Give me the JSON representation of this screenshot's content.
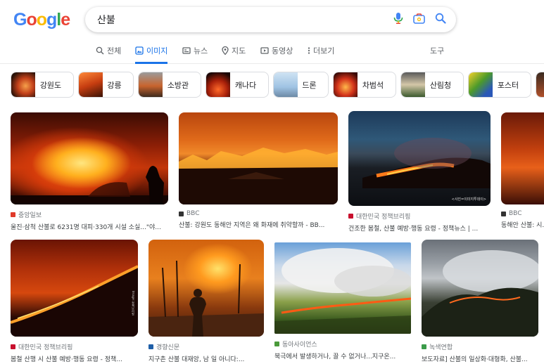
{
  "search": {
    "query": "산불"
  },
  "logo": {
    "letters": [
      "G",
      "o",
      "o",
      "g",
      "l",
      "e"
    ],
    "colors": [
      "#4285f4",
      "#ea4335",
      "#fbbc05",
      "#4285f4",
      "#34a853",
      "#ea4335"
    ]
  },
  "tabs": [
    {
      "label": "전체",
      "icon": "search-icon"
    },
    {
      "label": "이미지",
      "icon": "image-icon",
      "active": true
    },
    {
      "label": "뉴스",
      "icon": "news-icon"
    },
    {
      "label": "지도",
      "icon": "map-pin-icon"
    },
    {
      "label": "동영상",
      "icon": "video-icon"
    },
    {
      "label": "더보기",
      "icon": "more-icon"
    }
  ],
  "tools_label": "도구",
  "chips": [
    "강원도",
    "강릉",
    "소방관",
    "캐나다",
    "드론",
    "차범석",
    "산림청",
    "포스터"
  ],
  "results": [
    {
      "source": "중앙일보",
      "title": "울진·삼척 산불로 6231명 대피·330개 시설 소실...\"야...",
      "fav": "#e03a2a"
    },
    {
      "source": "BBC",
      "title": "산불: 강원도 동해안 지역은 왜 화재에 취약할까 - BB...",
      "fav": "#333333"
    },
    {
      "source": "대한민국 정책브리핑",
      "title": "건조한 봄철, 산불 예방·행동 요령 - 정책뉴스 | ...",
      "fav": "#c8102e"
    },
    {
      "source": "BBC",
      "title": "동해안 산불: 시...",
      "fav": "#333333"
    },
    {
      "source": "대한민국 정책브리핑",
      "title": "봄철 산행 시 산불 예방·행동 요령 - 정책...",
      "fav": "#c8102e"
    },
    {
      "source": "경향신문",
      "title": "지구촌 산불 대재앙, 남 일 아니다:...",
      "fav": "#1f5fa8"
    },
    {
      "source": "동아사이언스",
      "title": "북극에서 발생하거나, 끌 수 없거나...지구온...",
      "fav": "#4a9a3a"
    },
    {
      "source": "녹색연합",
      "title": "보도자료] 산불의 일상화·대형화, 산불...",
      "fav": "#3b9b4a"
    }
  ],
  "watermarks": {
    "result3": "<사진=이미지투데이>",
    "result5": "Image: 정책브리핑"
  }
}
